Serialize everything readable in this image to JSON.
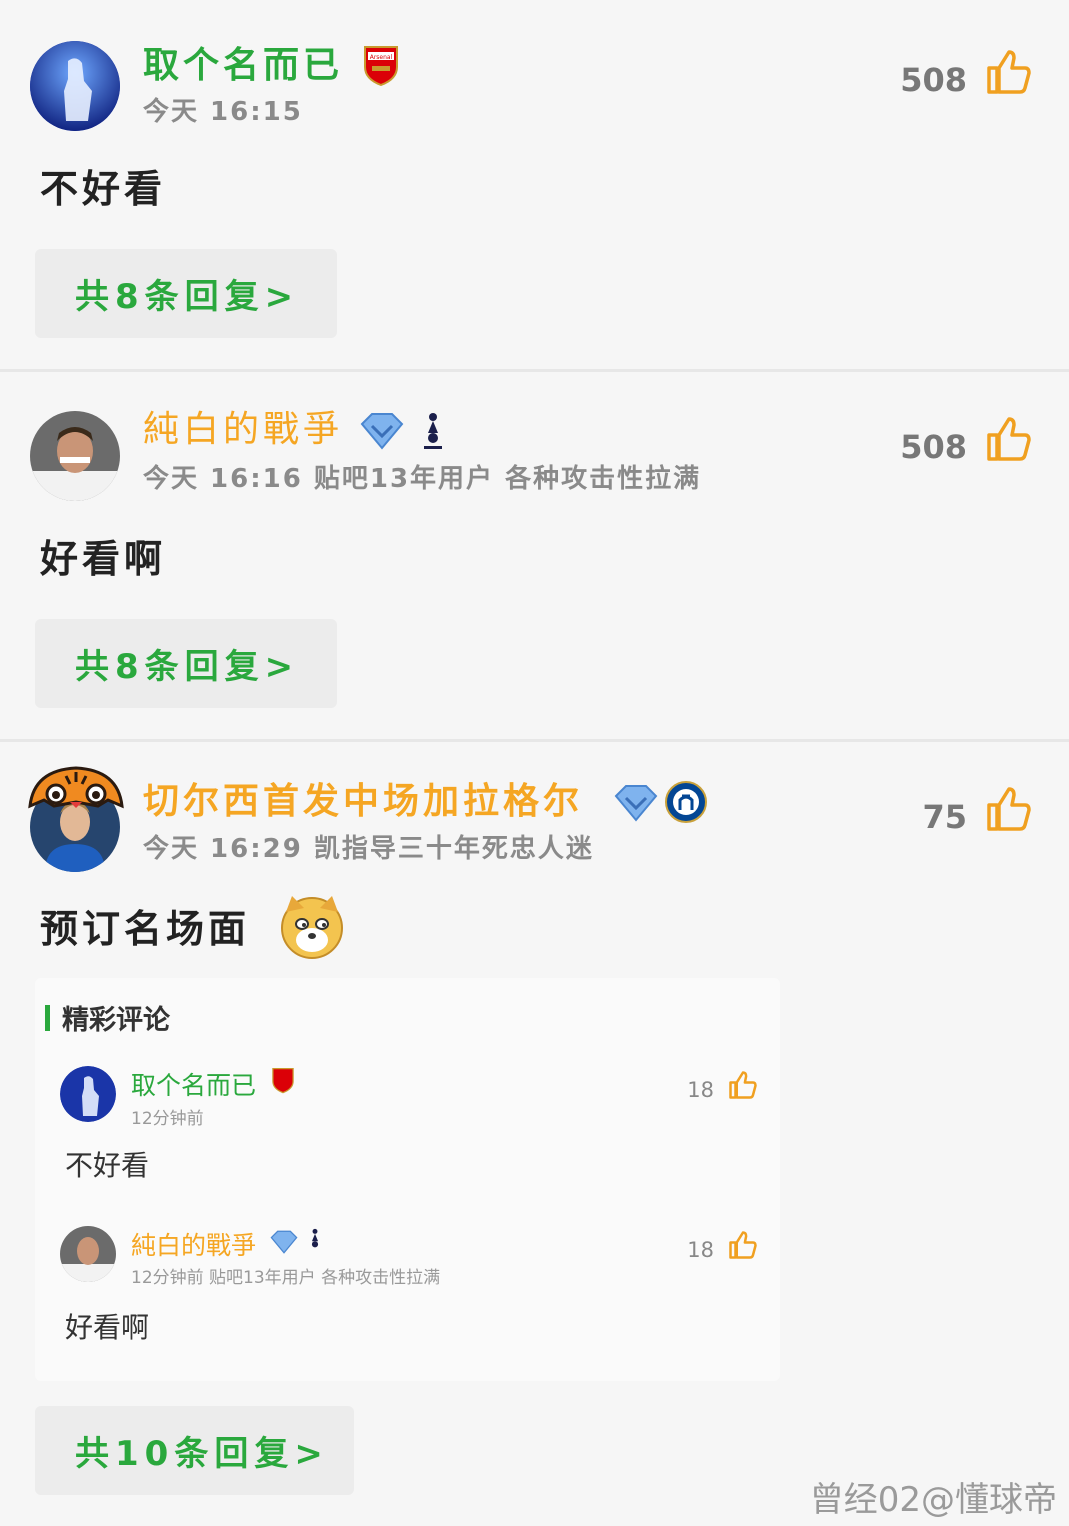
{
  "comments": [
    {
      "username": "取个名而已",
      "time": "今天 16:15",
      "likes": "508",
      "text": "不好看",
      "reply_label": "共8条回复>"
    },
    {
      "username": "純白的戰爭",
      "meta": "今天 16:16 贴吧13年用户 各种攻击性拉满",
      "likes": "508",
      "text": "好看啊",
      "reply_label": "共8条回复>"
    },
    {
      "username": "切尔西首发中场加拉格尔",
      "meta": "今天 16:29 凯指导三十年死忠人迷",
      "likes": "75",
      "text": "预订名场面",
      "reply_label": "共10条回复>"
    }
  ],
  "highlights": {
    "title": "精彩评论",
    "items": [
      {
        "username": "取个名而已",
        "meta": "12分钟前",
        "likes": "18",
        "text": "不好看"
      },
      {
        "username": "純白的戰爭",
        "meta": "12分钟前 贴吧13年用户 各种攻击性拉满",
        "likes": "18",
        "text": "好看啊"
      }
    ]
  },
  "watermark": "曾经02@懂球帝",
  "colors": {
    "green": "#2aa83d",
    "gold": "#f5a623",
    "thumb": "#f0a020"
  },
  "icons": [
    "thumbs-up-icon",
    "arsenal-badge-icon",
    "tottenham-badge-icon",
    "chelsea-badge-icon",
    "diamond-icon",
    "doge-emoji-icon"
  ]
}
